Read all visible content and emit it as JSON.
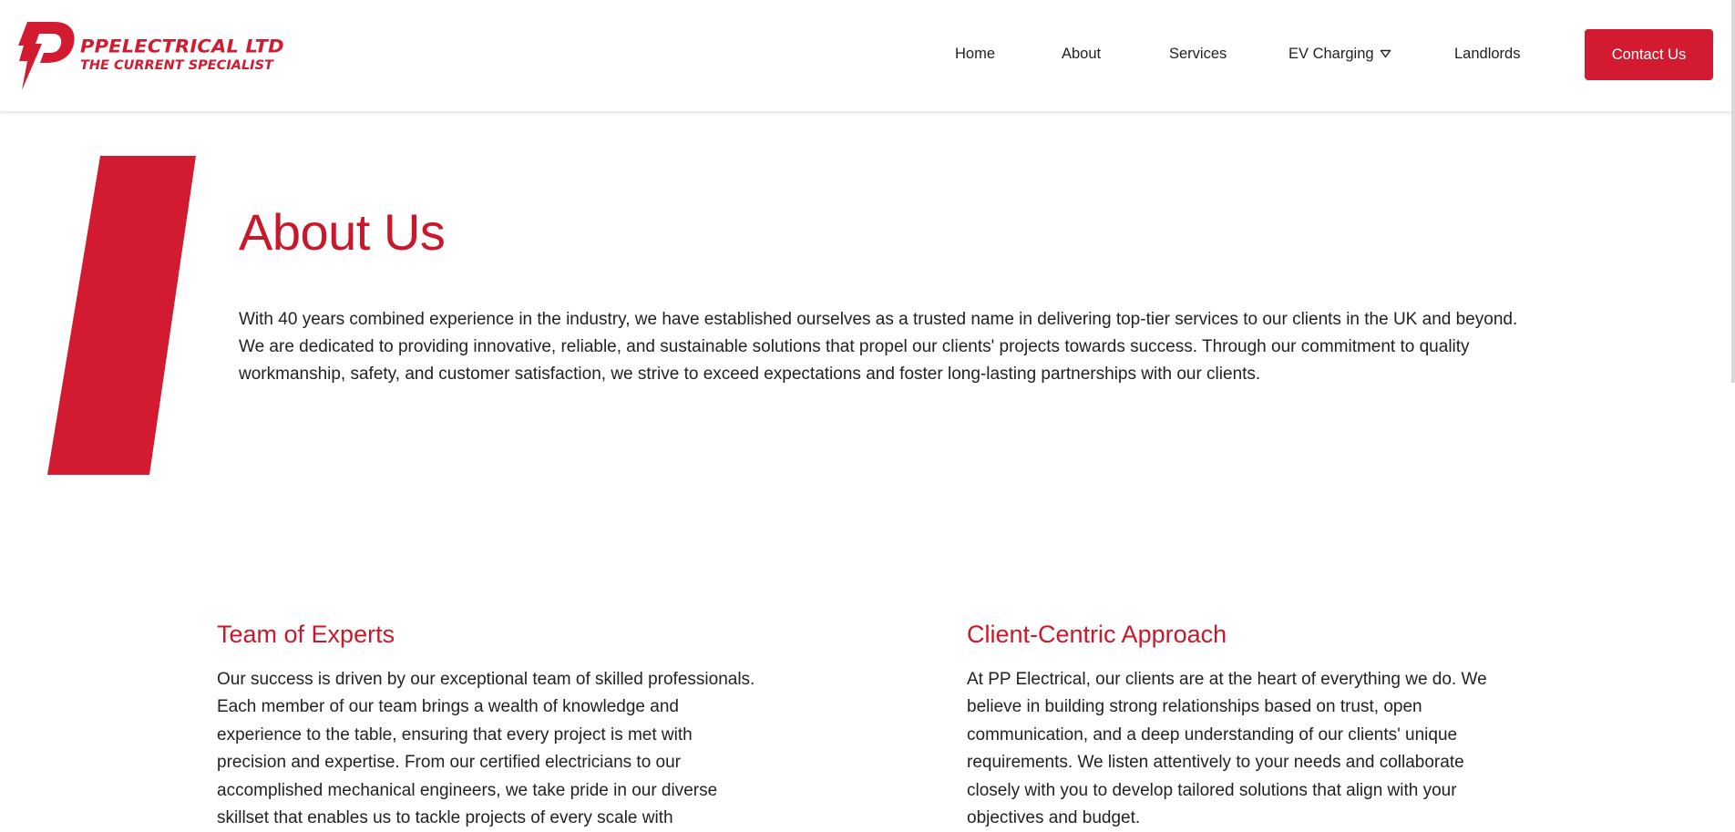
{
  "brand": {
    "name": "PPELECTRICAL LTD",
    "tagline": "THE CURRENT SPECIALIST",
    "logo_icon": "lightning-p-icon",
    "accent_color": "#d21a30"
  },
  "nav": {
    "items": [
      {
        "label": "Home"
      },
      {
        "label": "About"
      },
      {
        "label": "Services"
      },
      {
        "label": "EV Charging",
        "icon": "chevron-down-icon"
      },
      {
        "label": "Landlords"
      }
    ],
    "cta_label": "Contact Us"
  },
  "about": {
    "title": "About Us",
    "intro": "With 40 years combined experience in the industry, we have established ourselves as a trusted name in delivering top-tier services to our clients in the UK and beyond. We are dedicated to providing innovative, reliable, and sustainable solutions that propel our clients' projects towards success. Through our commitment to quality workmanship, safety, and customer satisfaction, we strive to exceed expectations and foster long-lasting partnerships with our clients."
  },
  "features": [
    {
      "title": "Team of Experts",
      "text": "Our success is driven by our exceptional team of skilled professionals. Each member of our team brings a wealth of knowledge and experience to the table, ensuring that every project is met with precision and expertise. From our certified electricians to our accomplished mechanical engineers, we take pride in our diverse skillset that enables us to tackle projects of every scale with"
    },
    {
      "title": "Client-Centric Approach",
      "text": "At PP Electrical, our clients are at the heart of everything we do. We believe in building strong relationships based on trust, open communication, and a deep understanding of our clients' unique requirements. We listen attentively to your needs and collaborate closely with you to develop tailored solutions that align with your objectives and budget."
    }
  ]
}
